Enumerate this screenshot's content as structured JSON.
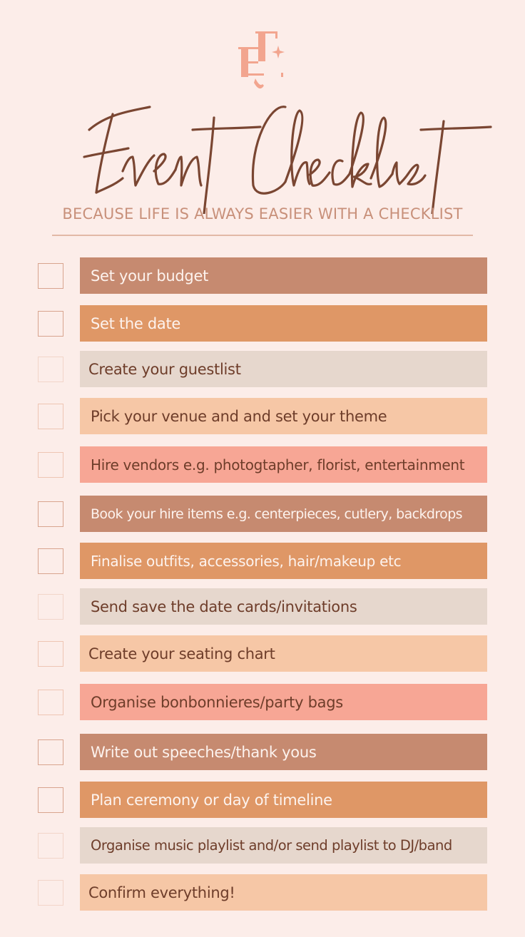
{
  "logo": {
    "icon": "monogram-logo-icon",
    "color": "#f2a58f"
  },
  "header": {
    "title": "Event Checklist",
    "subtitle": "BECAUSE LIFE IS ALWAYS EASIER WITH A CHECKLIST",
    "title_color": "#7a4632",
    "subtitle_color": "#c8907a"
  },
  "colors": {
    "background": "#fcede9",
    "mauve": "#c68a70",
    "orange": "#df9766",
    "taupe": "#e6d7cd",
    "peach": "#f6c7a6",
    "salmon": "#f7a695",
    "light_text": "#fdf3ee",
    "dark_text": "#6e3d2a"
  },
  "items": [
    {
      "label": "Set your budget",
      "checked": false
    },
    {
      "label": "Set the date",
      "checked": false
    },
    {
      "label": "Create your guestlist",
      "checked": false
    },
    {
      "label": "Pick your venue and and set your theme",
      "checked": false
    },
    {
      "label": "Hire vendors e.g. photogtapher, florist, entertainment",
      "checked": false
    },
    {
      "label": "Book your hire items e.g. centerpieces, cutlery, backdrops",
      "checked": false
    },
    {
      "label": "Finalise outfits, accessories, hair/makeup etc",
      "checked": false
    },
    {
      "label": "Send save the date cards/invitations",
      "checked": false
    },
    {
      "label": "Create your seating chart",
      "checked": false
    },
    {
      "label": "Organise bonbonnieres/party bags",
      "checked": false
    },
    {
      "label": "Write out speeches/thank yous",
      "checked": false
    },
    {
      "label": "Plan ceremony or day of timeline",
      "checked": false
    },
    {
      "label": "Organise music playlist and/or send playlist to DJ/band",
      "checked": false
    },
    {
      "label": "Confirm everything!",
      "checked": false
    }
  ]
}
